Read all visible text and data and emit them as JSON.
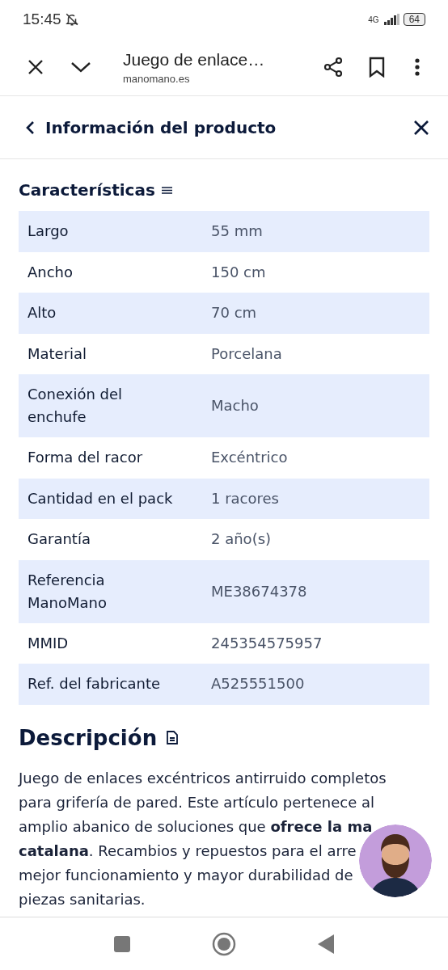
{
  "status_bar": {
    "time": "15:45",
    "network": "4G",
    "battery": "64"
  },
  "browser_bar": {
    "title": "Juego de enlace…",
    "url": "manomano.es"
  },
  "panel": {
    "title": "Información del producto"
  },
  "characteristics": {
    "heading": "Características",
    "rows": [
      {
        "label": "Largo",
        "value": "55 mm"
      },
      {
        "label": "Ancho",
        "value": "150 cm"
      },
      {
        "label": "Alto",
        "value": "70 cm"
      },
      {
        "label": "Material",
        "value": "Porcelana"
      },
      {
        "label": "Conexión del enchufe",
        "value": "Macho"
      },
      {
        "label": "Forma del racor",
        "value": "Excéntrico"
      },
      {
        "label": "Cantidad en el pack",
        "value": "1 racores"
      },
      {
        "label": "Garantía",
        "value": "2 año(s)"
      },
      {
        "label": "Referencia ManoMano",
        "value": "ME38674378"
      },
      {
        "label": "MMID",
        "value": "245354575957"
      },
      {
        "label": "Ref. del fabricante",
        "value": "A525551500"
      }
    ]
  },
  "description": {
    "heading": "Descripción",
    "lines": [
      "Juego de enlaces excéntricos antirruido completos",
      "para grifería de pared. Este artículo pertenece al",
      "amplio abanico de soluciones que **ofrece la ma**",
      "**catalana**. Recambios y repuestos para el arre",
      "mejor funcionamiento y mayor durabilidad de",
      "piezas sanitarias."
    ]
  }
}
